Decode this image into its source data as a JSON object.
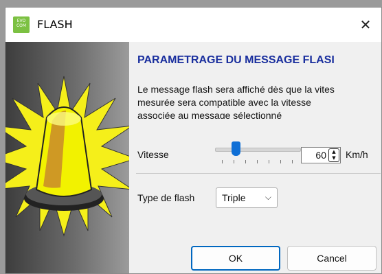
{
  "window": {
    "title": "FLASH",
    "icon_text_line1": "EVO",
    "icon_text_line2": "COM",
    "close_glyph": "✕"
  },
  "content": {
    "heading": "PARAMETRAGE DU MESSAGE FLASI",
    "description_lines": [
      "Le message flash sera affiché dès que la vites",
      "mesurée sera compatible avec la vitesse",
      "associée au message sélectionné"
    ]
  },
  "speed": {
    "label": "Vitesse",
    "value": "60",
    "unit": "Km/h",
    "slider_fraction": 0.24
  },
  "flash_type": {
    "label": "Type de flash",
    "selected": "Triple"
  },
  "buttons": {
    "ok": "OK",
    "cancel": "Cancel"
  },
  "icons": {
    "side_illustration": "flashing-beacon-icon",
    "spinner_up": "▲",
    "spinner_down": "▼",
    "chevron": "⌵"
  },
  "colors": {
    "heading": "#1a2f9e",
    "accent": "#0067c0",
    "app_icon": "#7cc142"
  }
}
